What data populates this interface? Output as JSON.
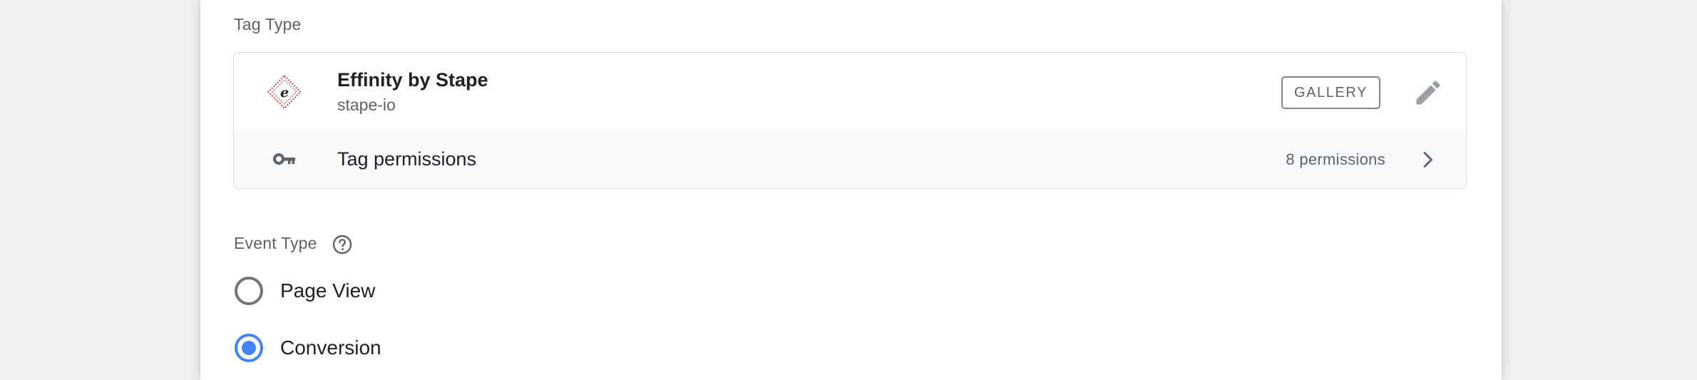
{
  "tag_type": {
    "section_label": "Tag Type",
    "template": {
      "name": "Effinity by Stape",
      "publisher": "stape-io",
      "logo_letter": "e",
      "gallery_label": "GALLERY"
    },
    "permissions": {
      "label": "Tag permissions",
      "count": "8 permissions"
    }
  },
  "event_type": {
    "section_label": "Event Type",
    "options": [
      {
        "label": "Page View",
        "checked": false
      },
      {
        "label": "Conversion",
        "checked": true
      }
    ]
  },
  "icons": {
    "logo": "effinity-logo-icon",
    "edit": "pencil-edit-icon",
    "permissions": "key-icon",
    "navigate": "chevron-right-icon",
    "help": "help-icon"
  },
  "colors": {
    "radio_checked": "#4285f4",
    "radio_unchecked": "#757575",
    "permissions_bg": "#f8f9fa",
    "border": "#dadce0"
  }
}
